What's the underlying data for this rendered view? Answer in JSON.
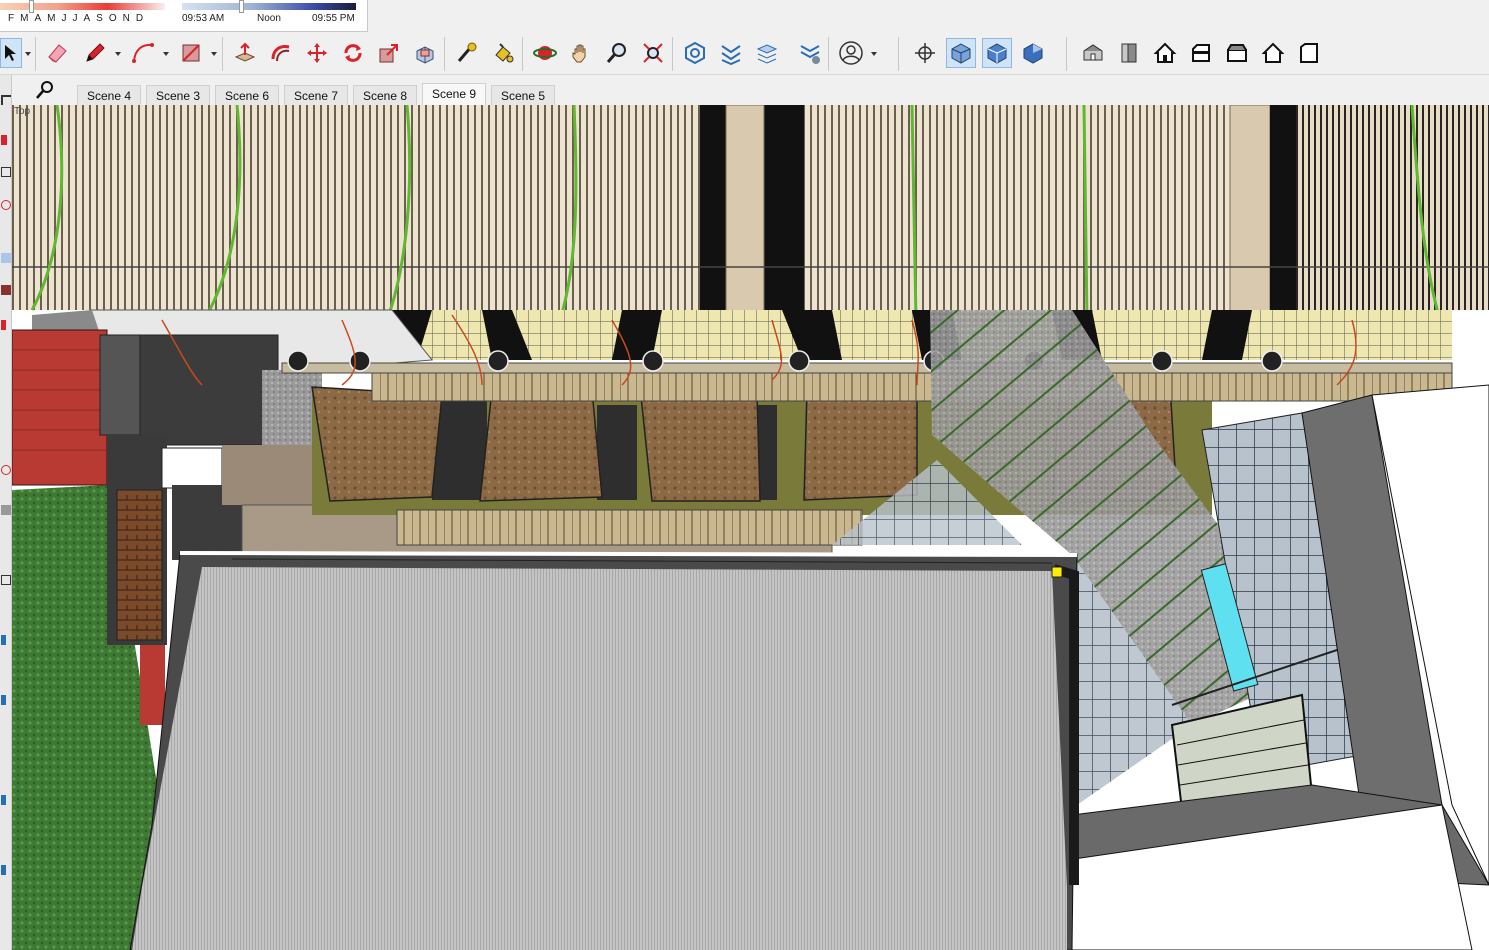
{
  "shadow_settings": {
    "months": [
      "F",
      "M",
      "A",
      "M",
      "J",
      "J",
      "A",
      "S",
      "O",
      "N",
      "D"
    ],
    "month_slider_value": "Feb",
    "time_start": "09:53 AM",
    "time_mid": "Noon",
    "time_end": "09:55 PM"
  },
  "toolbar": {
    "tools": [
      "select-icon",
      "eraser-icon",
      "pencil-icon",
      "arc-icon",
      "shape-icon",
      "push-pull-icon",
      "follow-me-icon",
      "move-icon",
      "rotate-icon",
      "scale-icon",
      "offset-icon",
      "tape-measure-icon",
      "paint-bucket-icon",
      "orbit-icon",
      "pan-icon",
      "zoom-icon",
      "zoom-extents-icon",
      "warehouse-icon",
      "extension-icon",
      "layers-icon",
      "styles-icon",
      "account-icon",
      "position-camera-icon",
      "xray-icon",
      "back-edges-icon",
      "wireframe-icon",
      "iso-view-icon",
      "top-view-icon",
      "front-view-icon",
      "right-view-icon",
      "back-view-icon",
      "left-view-icon",
      "bottom-view-icon"
    ]
  },
  "scene_tabs": [
    {
      "label": "Scene 4",
      "active": false
    },
    {
      "label": "Scene 3",
      "active": false
    },
    {
      "label": "Scene 6",
      "active": false
    },
    {
      "label": "Scene 7",
      "active": false
    },
    {
      "label": "Scene 8",
      "active": false
    },
    {
      "label": "Scene 9",
      "active": true
    },
    {
      "label": "Scene 5",
      "active": false
    }
  ],
  "viewport": {
    "view_name": "Top"
  },
  "colors": {
    "accent": "#2a6db5",
    "tool_red": "#d8232a",
    "selected_tool_bg": "#cfe4f7"
  }
}
